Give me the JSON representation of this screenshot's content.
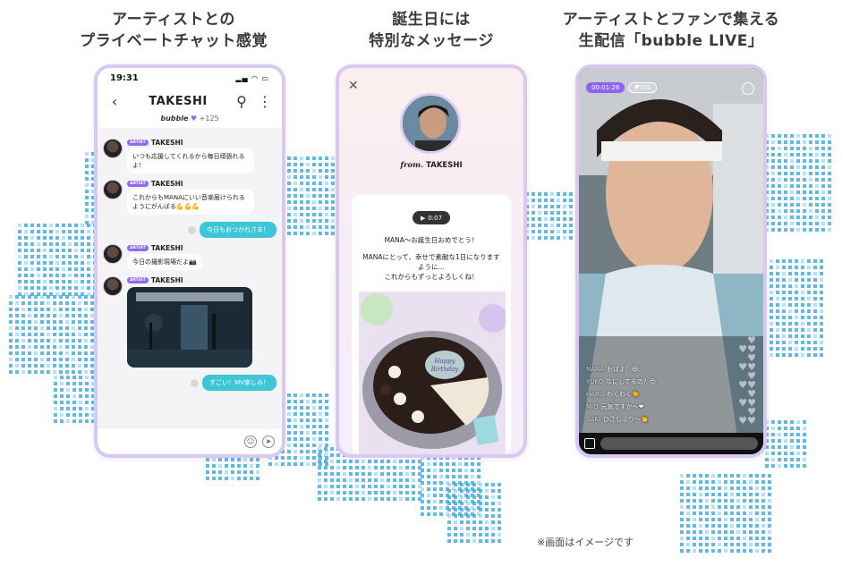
{
  "captions": [
    {
      "line1": "アーティストとの",
      "line2": "プライベートチャット感覚"
    },
    {
      "line1": "誕生日には",
      "line2": "特別なメッセージ"
    },
    {
      "line1": "アーティストとファンで集える",
      "line2": "生配信「bubble LIVE」"
    }
  ],
  "chat": {
    "time": "19:31",
    "title": "TAKESHI",
    "bubble_brand": "bubble",
    "bubble_count": "+125",
    "artist_tag": "ARTIST",
    "messages": [
      {
        "sender": "TAKESHI",
        "text": "いつも応援してくれるから毎日頑張れるよ！"
      },
      {
        "sender": "TAKESHI",
        "text": "これからもMANAにいい音楽届けられるようにがんばる💪💪💪"
      },
      {
        "out": "今日もおつかれさま！"
      },
      {
        "sender": "TAKESHI",
        "text": "今日の撮影現場だよ📷"
      },
      {
        "sender": "TAKESHI",
        "photo": true
      },
      {
        "out": "すごい！MV楽しみ！"
      }
    ]
  },
  "bday": {
    "from_label": "from.",
    "from_name": "TAKESHI",
    "audio": "0:07",
    "line1": "MANA〜お誕生日おめでとう！",
    "line2": "MANAにとって、幸せで素敵な1日になりますように…",
    "line3": "これからもずっとよろしくね！",
    "cake_text": "Happy Birthday"
  },
  "live": {
    "timer": "00:01:26",
    "viewers": "500",
    "comments": [
      {
        "name": "NANA",
        "text": "おはよ！😆"
      },
      {
        "name": "YUKO",
        "text": "なにしてるの？😍"
      },
      {
        "name": "HARU",
        "text": "わくわく🐤"
      },
      {
        "name": "MIO",
        "text": "元気ですか〜❤"
      },
      {
        "name": "SAKI",
        "text": "ひさしぶり〜👏"
      }
    ]
  },
  "note": "※画面はイメージです",
  "colors": {
    "accent": "#8b6cf0",
    "teal": "#3ec6d6",
    "frame": "#d9c8ef",
    "dots": "#39a7e0"
  }
}
